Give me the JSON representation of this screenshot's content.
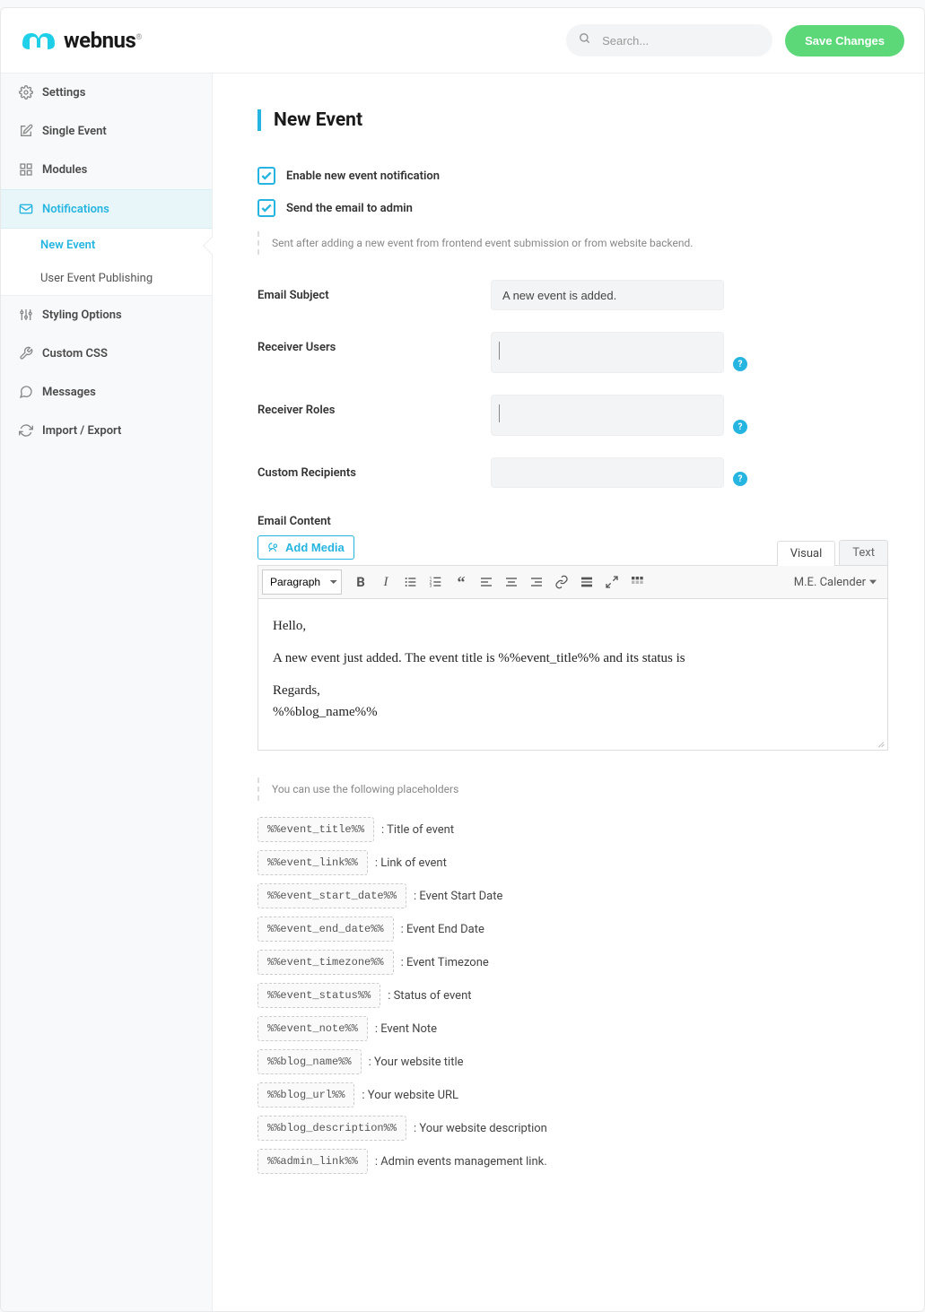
{
  "header": {
    "logo_text": "webnus",
    "search_placeholder": "Search...",
    "save_label": "Save Changes"
  },
  "sidebar": {
    "items": [
      {
        "label": "Settings",
        "icon": "gear"
      },
      {
        "label": "Single Event",
        "icon": "edit"
      },
      {
        "label": "Modules",
        "icon": "grid"
      },
      {
        "label": "Notifications",
        "icon": "mail",
        "active": true,
        "sub": [
          {
            "label": "New Event",
            "active": true
          },
          {
            "label": "User Event Publishing"
          }
        ]
      },
      {
        "label": "Styling Options",
        "icon": "sliders"
      },
      {
        "label": "Custom CSS",
        "icon": "wrench"
      },
      {
        "label": "Messages",
        "icon": "chat"
      },
      {
        "label": "Import / Export",
        "icon": "refresh"
      }
    ]
  },
  "page": {
    "title": "New Event",
    "enable_label": "Enable new event notification",
    "send_admin_label": "Send the email to admin",
    "note": "Sent after adding a new event from frontend event submission or from website backend.",
    "fields": {
      "email_subject_label": "Email Subject",
      "email_subject_value": "A new event is added.",
      "receiver_users_label": "Receiver Users",
      "receiver_roles_label": "Receiver Roles",
      "custom_recipients_label": "Custom Recipients"
    },
    "editor": {
      "label": "Email Content",
      "add_media": "Add Media",
      "tab_visual": "Visual",
      "tab_text": "Text",
      "format_select": "Paragraph",
      "calendar_dd": "M.E. Calender",
      "content_line1": "Hello,",
      "content_line2": "A new event just added. The event title is %%event_title%% and its status is",
      "content_line3": "Regards,",
      "content_line4": "%%blog_name%%"
    },
    "placeholders_label": "You can use the following placeholders",
    "placeholders": [
      {
        "tag": "%%event_title%%",
        "desc": ": Title of event"
      },
      {
        "tag": "%%event_link%%",
        "desc": ": Link of event"
      },
      {
        "tag": "%%event_start_date%%",
        "desc": ": Event Start Date"
      },
      {
        "tag": "%%event_end_date%%",
        "desc": ": Event End Date"
      },
      {
        "tag": "%%event_timezone%%",
        "desc": ": Event Timezone"
      },
      {
        "tag": "%%event_status%%",
        "desc": ": Status of event"
      },
      {
        "tag": "%%event_note%%",
        "desc": ": Event Note"
      },
      {
        "tag": "%%blog_name%%",
        "desc": ": Your website title"
      },
      {
        "tag": "%%blog_url%%",
        "desc": ": Your website URL"
      },
      {
        "tag": "%%blog_description%%",
        "desc": ": Your website description"
      },
      {
        "tag": "%%admin_link%%",
        "desc": ": Admin events management link."
      }
    ]
  }
}
